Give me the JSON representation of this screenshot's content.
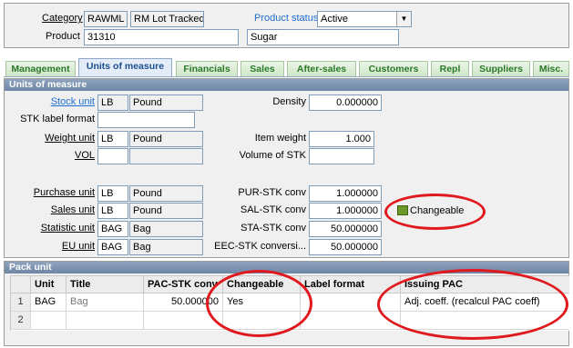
{
  "header": {
    "category_label": "Category",
    "category_code": "RAWML",
    "category_desc": "RM Lot Tracked",
    "product_status_label": "Product status",
    "product_status_value": "Active",
    "product_label": "Product",
    "product_code": "31310",
    "product_desc": "Sugar"
  },
  "tabs": [
    {
      "label": "Management"
    },
    {
      "label": "Units of measure"
    },
    {
      "label": "Financials"
    },
    {
      "label": "Sales"
    },
    {
      "label": "After-sales"
    },
    {
      "label": "Customers"
    },
    {
      "label": "Repl"
    },
    {
      "label": "Suppliers"
    },
    {
      "label": "Misc."
    }
  ],
  "uom": {
    "title": "Units of measure",
    "stock_unit_label": "Stock unit",
    "stock_unit_code": "LB",
    "stock_unit_desc": "Pound",
    "stk_label_format_label": "STK label format",
    "stk_label_format_value": "",
    "weight_unit_label": "Weight unit",
    "weight_unit_code": "LB",
    "weight_unit_desc": "Pound",
    "vol_label": "VOL",
    "vol_code": "",
    "vol_desc": "",
    "density_label": "Density",
    "density_value": "0.000000",
    "item_weight_label": "Item weight",
    "item_weight_value": "1.000",
    "volume_of_stk_label": "Volume of STK",
    "volume_of_stk_value": "",
    "purchase_unit_label": "Purchase unit",
    "purchase_unit_code": "LB",
    "purchase_unit_desc": "Pound",
    "sales_unit_label": "Sales unit",
    "sales_unit_code": "LB",
    "sales_unit_desc": "Pound",
    "statistic_unit_label": "Statistic unit",
    "statistic_unit_code": "BAG",
    "statistic_unit_desc": "Bag",
    "eu_unit_label": "EU unit",
    "eu_unit_code": "BAG",
    "eu_unit_desc": "Bag",
    "pur_stk_label": "PUR-STK conv",
    "pur_stk_value": "1.000000",
    "sal_stk_label": "SAL-STK conv",
    "sal_stk_value": "1.000000",
    "sta_stk_label": "STA-STK conv",
    "sta_stk_value": "50.000000",
    "eec_stk_label": "EEC-STK conversi...",
    "eec_stk_value": "50.000000",
    "changeable_label": "Changeable"
  },
  "pack": {
    "title": "Pack unit",
    "columns": [
      "Unit",
      "Title",
      "PAC-STK conv",
      "Changeable",
      "Label format",
      "Issuing PAC"
    ],
    "rows": [
      {
        "num": "1",
        "unit": "BAG",
        "title": "Bag",
        "conv": "50.000000",
        "changeable": "Yes",
        "label_format": "",
        "issuing": "Adj. coeff. (recalcul PAC coeff)"
      },
      {
        "num": "2",
        "unit": "",
        "title": "",
        "conv": "",
        "changeable": "",
        "label_format": "",
        "issuing": ""
      }
    ]
  },
  "colors": {
    "annotation": "#e0191e",
    "section_header": "#7890ae",
    "tab_text": "#2a7a2a",
    "link_blue": "#1f6fd0"
  }
}
